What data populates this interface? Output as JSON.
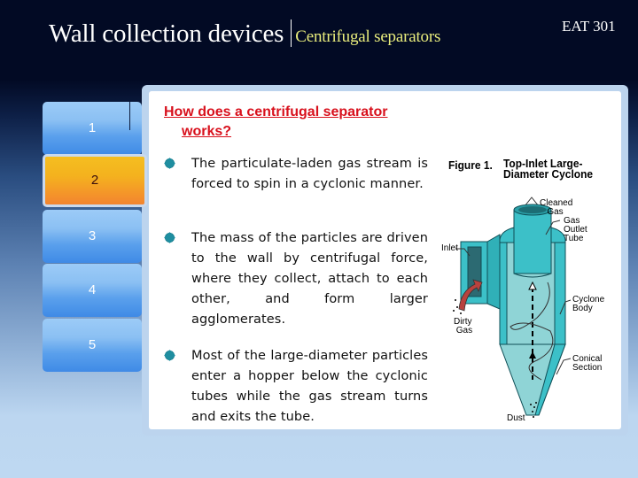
{
  "header": {
    "title": "Wall collection devices",
    "subtitle": "Centrifugal separators",
    "course_code": "EAT 301"
  },
  "tabs": [
    {
      "label": "1",
      "active": false
    },
    {
      "label": "2",
      "active": true
    },
    {
      "label": "3",
      "active": false
    },
    {
      "label": "4",
      "active": false
    },
    {
      "label": "5",
      "active": false
    }
  ],
  "content": {
    "heading_line1": "How does a centrifugal separator",
    "heading_line2": "works?",
    "bullets": [
      "The particulate-laden gas stream is forced to spin in a cyclonic manner.",
      "The mass of the particles are driven to the wall by centrifugal force, where they collect, attach to each other, and form larger agglomerates.",
      "Most of the large-diameter particles enter a hopper below the cyclonic tubes while the gas stream turns and exits the tube."
    ]
  },
  "figure": {
    "caption_number": "Figure 1.",
    "caption_line1": "Top-Inlet Large-",
    "caption_line2": "Diameter Cyclone",
    "labels": {
      "cleaned_gas_1": "Cleaned",
      "cleaned_gas_2": "Gas",
      "gas_outlet_1": "Gas",
      "gas_outlet_2": "Outlet",
      "gas_outlet_3": "Tube",
      "inlet": "Inlet",
      "cyclone_body_1": "Cyclone",
      "cyclone_body_2": "Body",
      "dirty_gas_1": "Dirty",
      "dirty_gas_2": "Gas",
      "conical_1": "Conical",
      "conical_2": "Section",
      "dust": "Dust"
    }
  },
  "colors": {
    "heading": "#d8101c",
    "subtitle": "#e8ec7c",
    "active_tab": "#f4a824",
    "tab": "#5aa0ec",
    "cyclone": "#3cc0c8"
  }
}
